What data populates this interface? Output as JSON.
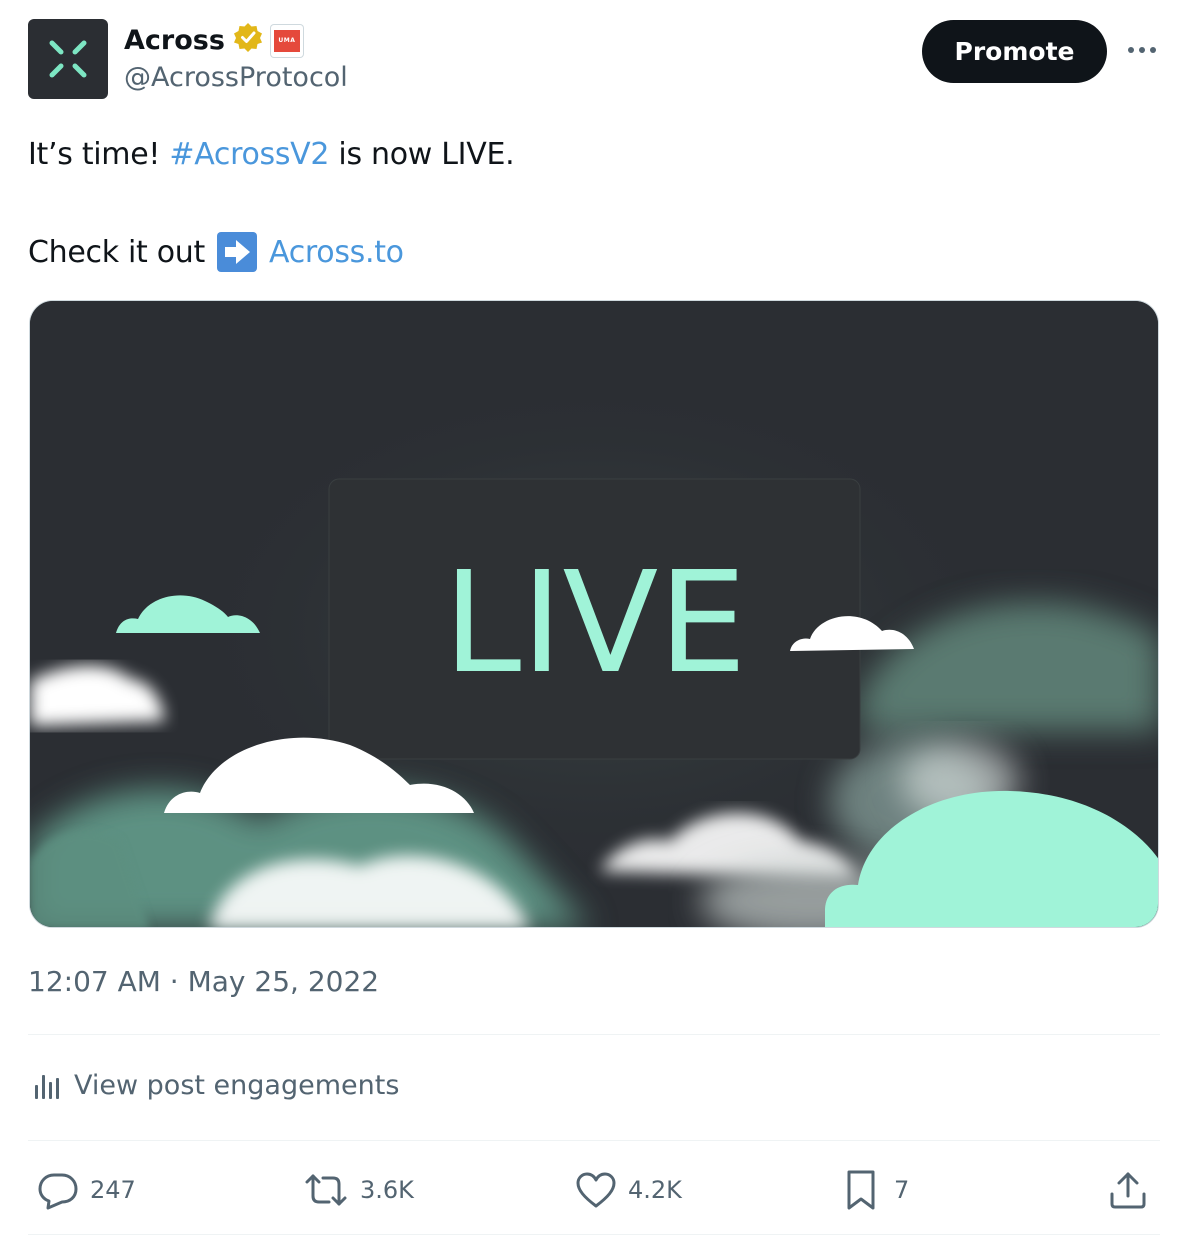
{
  "author": {
    "name": "Across",
    "handle": "@AcrossProtocol",
    "affiliate_label": "UMA"
  },
  "header": {
    "promote_label": "Promote"
  },
  "tweet": {
    "line1_pre": "It’s time! ",
    "hashtag": "#AcrossV2",
    "line1_post": " is now LIVE.",
    "line2_pre": "Check it out",
    "link": "Across.to"
  },
  "media": {
    "image_text": "LIVE"
  },
  "meta": {
    "time": "12:07 AM",
    "separator": " · ",
    "date": "May 25, 2022"
  },
  "engagements_label": "View post engagements",
  "actions": {
    "replies": "247",
    "reposts": "3.6K",
    "likes": "4.2K",
    "bookmarks": "7"
  },
  "colors": {
    "accent_link": "#4a97dc",
    "mint": "#a0f3d8",
    "dark_bg": "#2b2e33"
  }
}
